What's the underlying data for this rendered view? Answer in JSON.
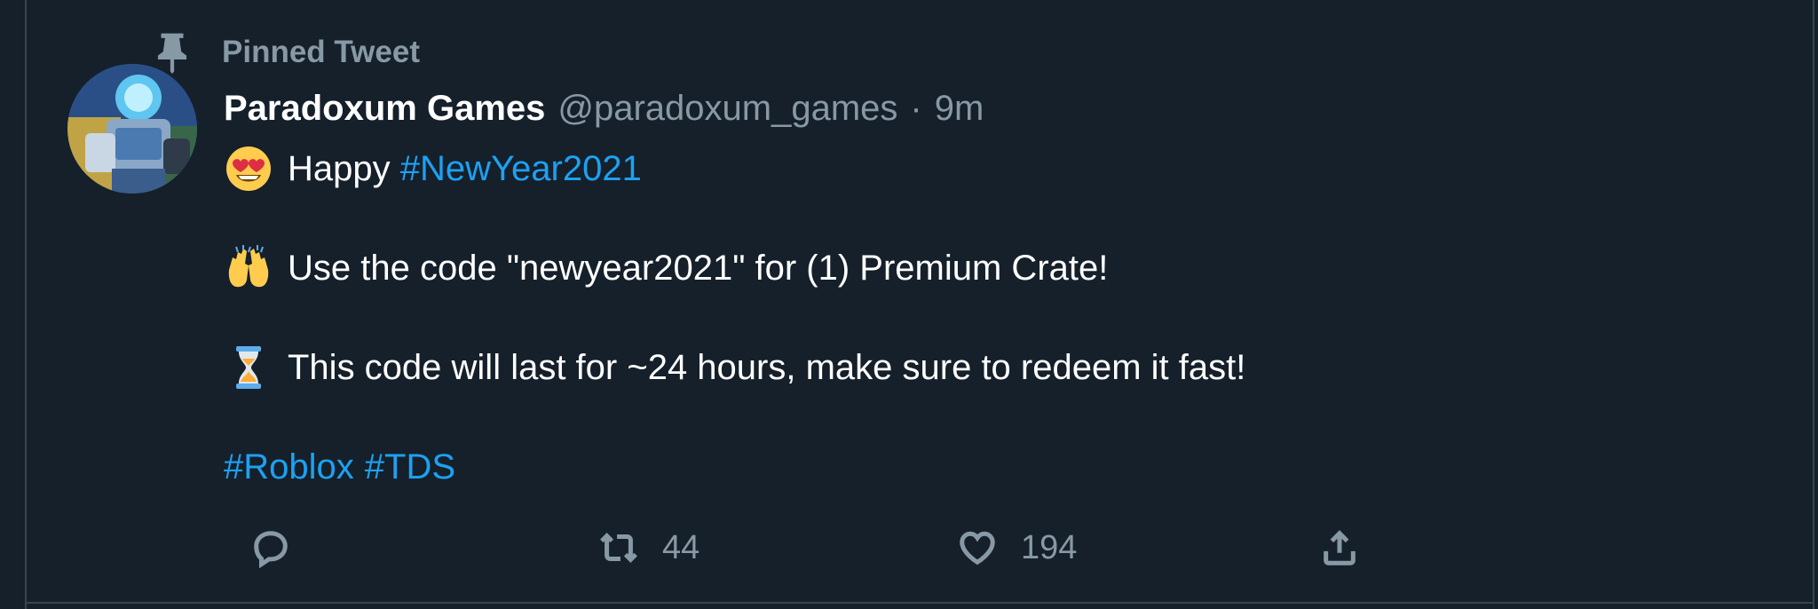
{
  "colors": {
    "background": "#15202b",
    "border": "#38444d",
    "secondary_text": "#8899a6",
    "primary_text": "#ffffff",
    "link": "#1da1f2"
  },
  "pinned": {
    "icon": "pin-icon",
    "label": "Pinned Tweet"
  },
  "tweet": {
    "display_name": "Paradoxum Games",
    "handle": "@paradoxum_games",
    "separator": "·",
    "time": "9m",
    "lines": [
      {
        "emoji": "heart-eyes-emoji",
        "text": "Happy ",
        "hashtag": "#NewYear2021"
      },
      {
        "emoji": "raising-hands-emoji",
        "text": "Use the code \"newyear2021\" for (1) Premium Crate!"
      },
      {
        "emoji": "hourglass-emoji",
        "text": "This code will last for ~24 hours, make sure to redeem it fast!"
      }
    ],
    "hashtags_line": [
      "#Roblox",
      "#TDS"
    ]
  },
  "actions": {
    "reply": {
      "icon": "reply-icon",
      "count": ""
    },
    "retweet": {
      "icon": "retweet-icon",
      "count": "44"
    },
    "like": {
      "icon": "heart-icon",
      "count": "194"
    },
    "share": {
      "icon": "share-icon"
    }
  }
}
